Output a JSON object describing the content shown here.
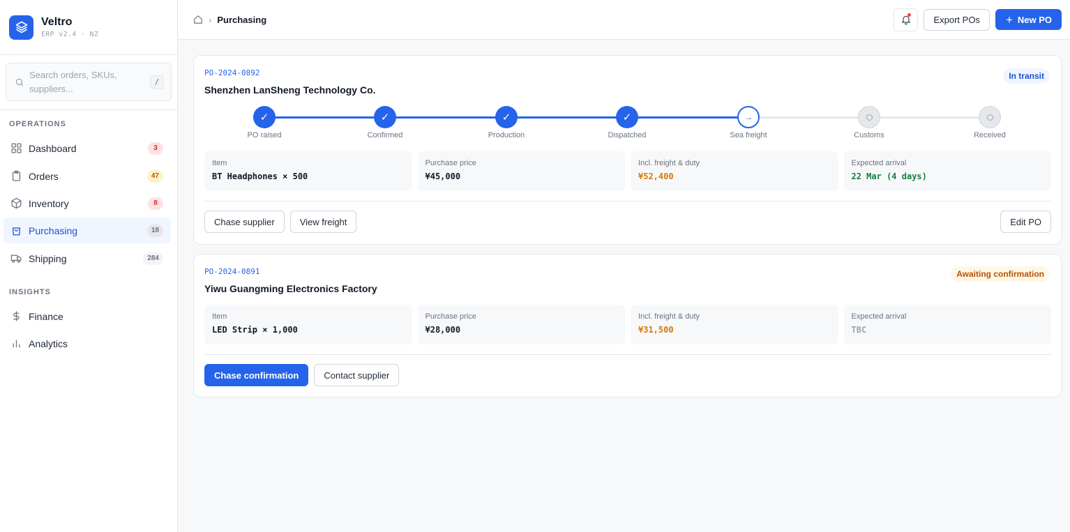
{
  "brand": {
    "name": "Veltro",
    "sub": "ERP v2.4 · NZ"
  },
  "search": {
    "placeholder": "Search orders, SKUs, suppliers...",
    "shortcut": "/"
  },
  "nav": {
    "sections": [
      "OPERATIONS",
      "INSIGHTS"
    ],
    "operations": [
      {
        "label": "Dashboard",
        "badge": "3",
        "icon": "grid-icon"
      },
      {
        "label": "Orders",
        "badge": "47",
        "icon": "clipboard-icon"
      },
      {
        "label": "Inventory",
        "badge": "8",
        "icon": "box-icon"
      },
      {
        "label": "Purchasing",
        "badge": "18",
        "icon": "shopping-bag-icon",
        "active": true
      },
      {
        "label": "Shipping",
        "badge": "284",
        "icon": "truck-icon"
      }
    ],
    "insights": [
      {
        "label": "Finance",
        "icon": "dollar-icon"
      },
      {
        "label": "Analytics",
        "icon": "bar-chart-icon"
      }
    ]
  },
  "topbar": {
    "breadcrumb": "Purchasing",
    "export_label": "Export POs",
    "new_label": "New PO"
  },
  "orders": [
    {
      "id": "PO-2024-0892",
      "supplier": "Shenzhen LanSheng Technology Co.",
      "status": "In transit",
      "steps": [
        {
          "label": "PO raised",
          "state": "done"
        },
        {
          "label": "Confirmed",
          "state": "done"
        },
        {
          "label": "Production",
          "state": "done"
        },
        {
          "label": "Dispatched",
          "state": "done"
        },
        {
          "label": "Sea freight",
          "state": "current"
        },
        {
          "label": "Customs",
          "state": "pending"
        },
        {
          "label": "Received",
          "state": "pending"
        }
      ],
      "stats": [
        {
          "label": "Item",
          "value": "BT Headphones × 500"
        },
        {
          "label": "Purchase price",
          "value": "¥45,000"
        },
        {
          "label": "Incl. freight & duty",
          "value": "¥52,400"
        },
        {
          "label": "Expected arrival",
          "value": "22 Mar (4 days)"
        }
      ],
      "actions": [
        "Chase supplier",
        "View freight"
      ],
      "edit_label": "Edit PO"
    },
    {
      "id": "PO-2024-0891",
      "supplier": "Yiwu Guangming Electronics Factory",
      "status": "Awaiting confirmation",
      "stats": [
        {
          "label": "Item",
          "value": "LED Strip × 1,000"
        },
        {
          "label": "Purchase price",
          "value": "¥28,000"
        },
        {
          "label": "Incl. freight & duty",
          "value": "¥31,500"
        },
        {
          "label": "Expected arrival",
          "value": "TBC"
        }
      ],
      "actions": [
        "Chase confirmation",
        "Contact supplier"
      ]
    }
  ],
  "colors": {
    "accent": "#2563eb",
    "amber": "#d97706",
    "green": "#15803d"
  }
}
